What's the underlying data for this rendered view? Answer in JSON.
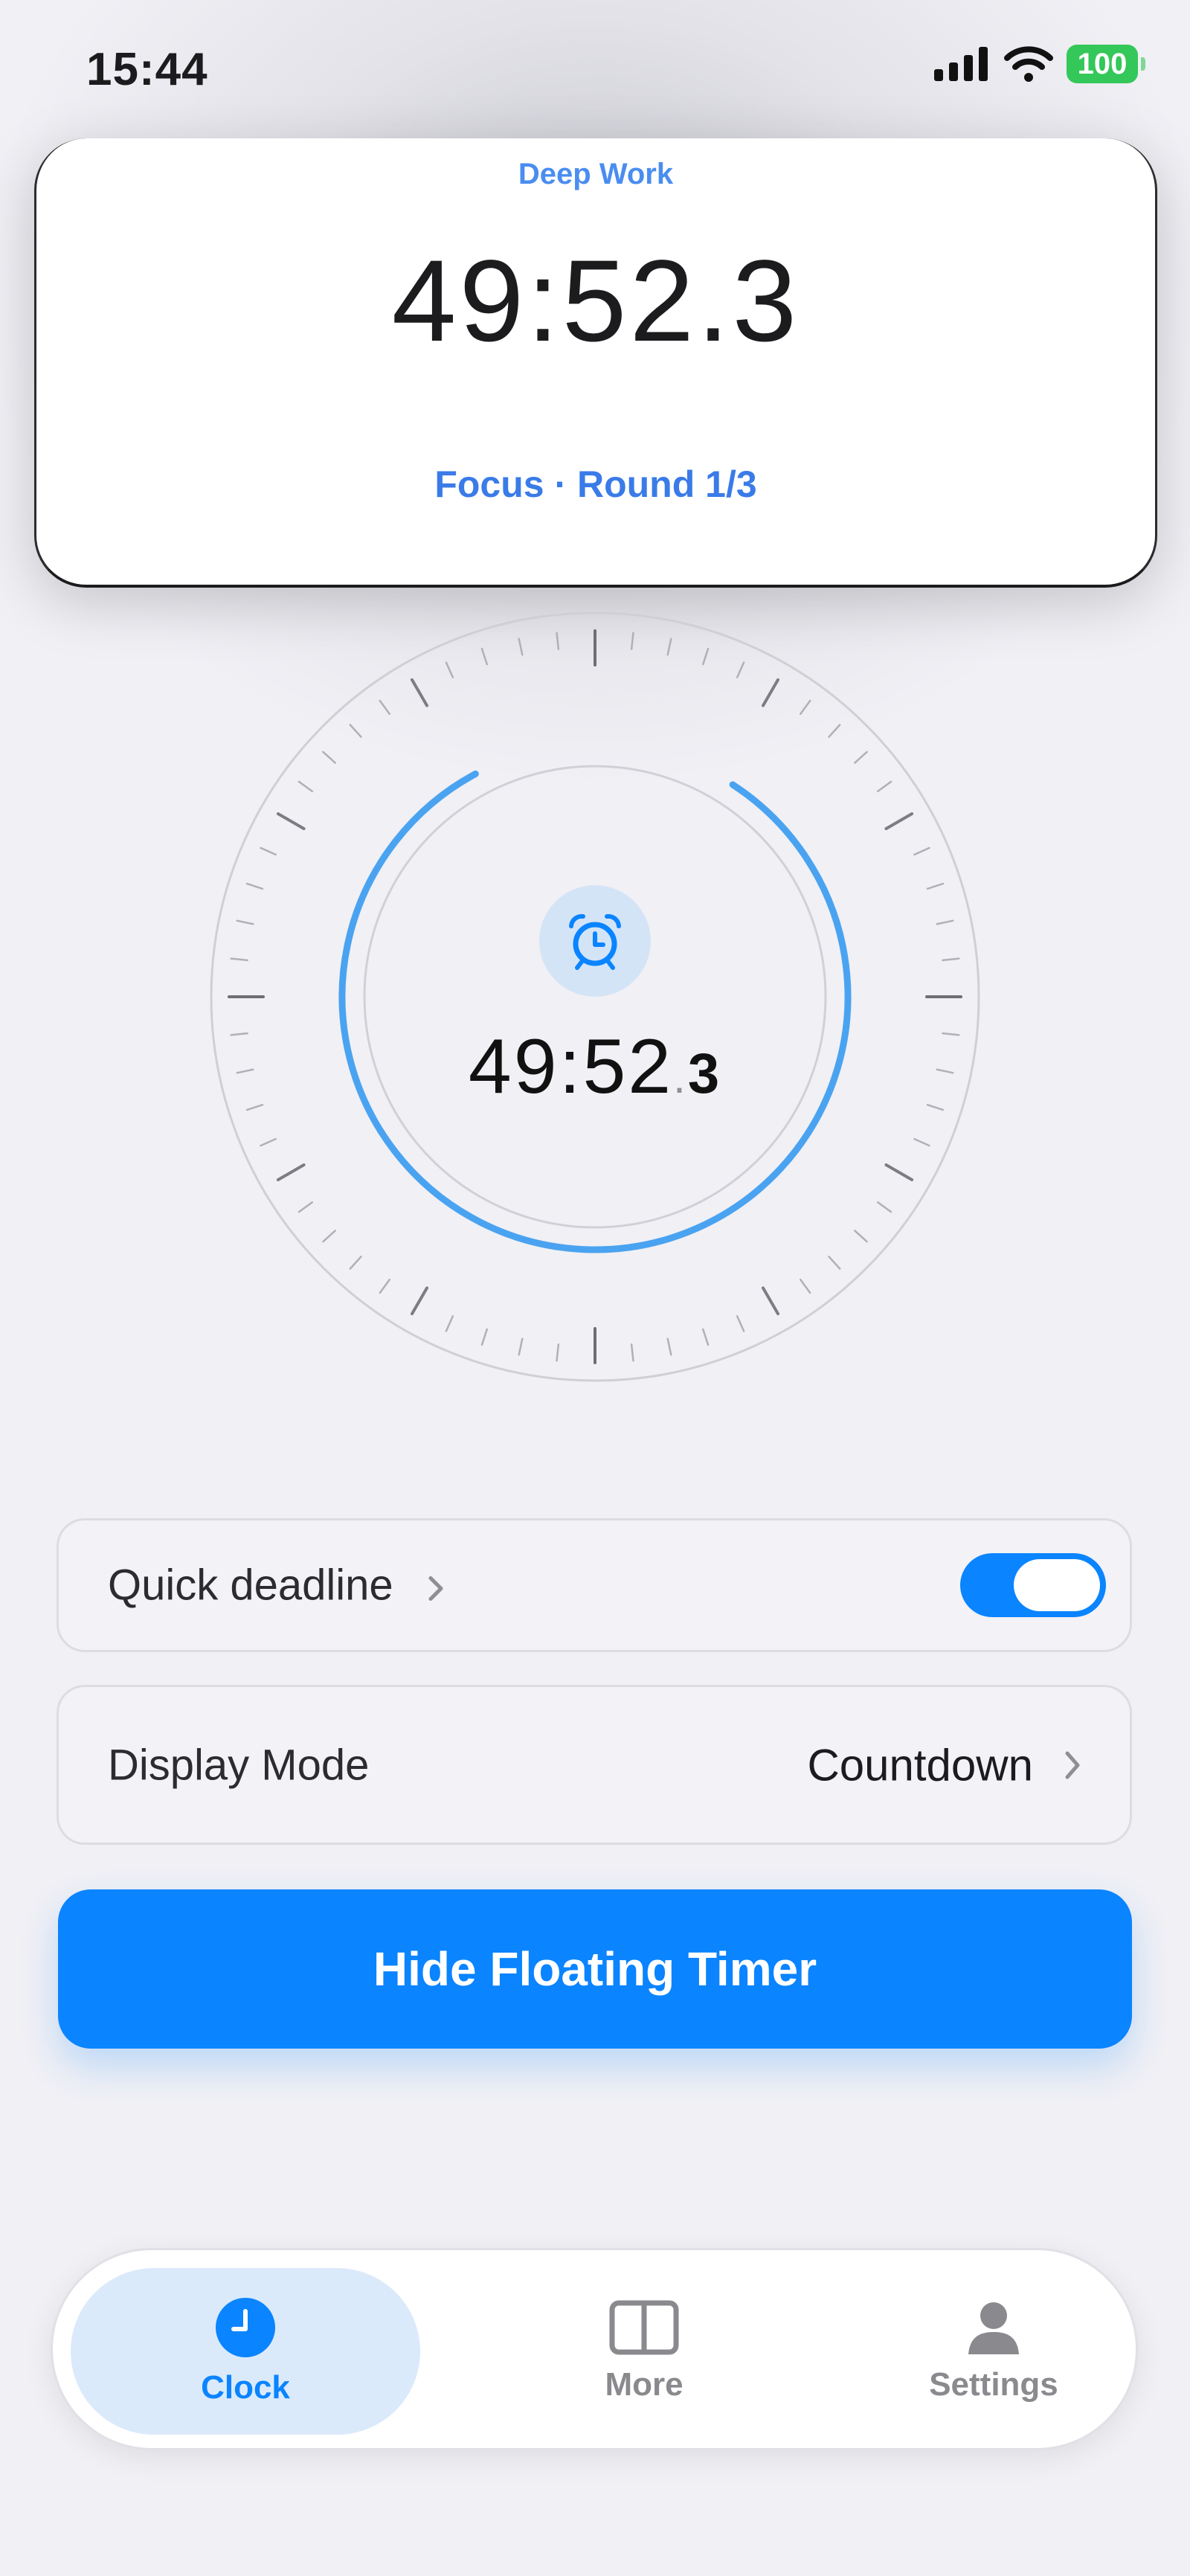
{
  "status_bar": {
    "time": "15:44",
    "battery": "100",
    "icons": [
      "signal-icon",
      "wifi-icon",
      "battery-icon"
    ]
  },
  "floating_timer": {
    "title": "Deep Work",
    "time": "49:52.3",
    "subtitle": "Focus · Round 1/3"
  },
  "dial": {
    "icon": "alarm-clock-icon",
    "time_main": "49:52",
    "time_sep": ".",
    "time_tenth": "3",
    "progress_fraction": 0.83
  },
  "rows": {
    "deadline_label": "Quick deadline",
    "deadline_toggle_on": true,
    "display_mode_label": "Display Mode",
    "display_mode_value": "Countdown"
  },
  "main_button": "Hide Floating Timer",
  "tabs": [
    {
      "label": "Clock",
      "icon": "clock-icon",
      "active": true
    },
    {
      "label": "More",
      "icon": "split-view-icon",
      "active": false
    },
    {
      "label": "Settings",
      "icon": "person-icon",
      "active": false
    }
  ],
  "colors": {
    "accent": "#0a84ff",
    "progress_ring": "#4aa3f0",
    "battery": "#34c759",
    "background": "#f0f0f5"
  }
}
